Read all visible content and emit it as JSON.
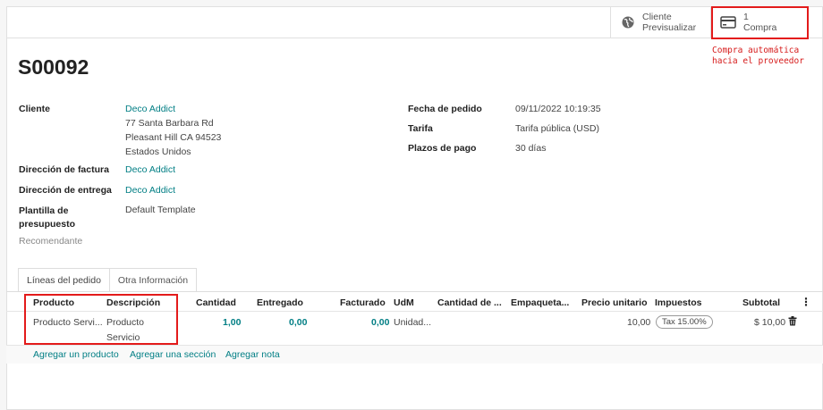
{
  "topbar": {
    "preview_label_1": "Cliente",
    "preview_label_2": "Previsualizar",
    "compra_count": "1",
    "compra_label": "Compra"
  },
  "annotation": {
    "line1": "Compra automática",
    "line2": "hacia el proveedor"
  },
  "order": {
    "name": "S00092"
  },
  "left_fields": {
    "cliente_label": "Cliente",
    "cliente_name": "Deco Addict",
    "cliente_addr1": "77 Santa Barbara Rd",
    "cliente_addr2": "Pleasant Hill CA 94523",
    "cliente_addr3": "Estados Unidos",
    "factura_label": "Dirección de factura",
    "factura_value": "Deco Addict",
    "entrega_label": "Dirección de entrega",
    "entrega_value": "Deco Addict",
    "plantilla_label_1": "Plantilla de",
    "plantilla_label_2": "presupuesto",
    "plantilla_value": "Default Template",
    "recomendante_label": "Recomendante"
  },
  "right_fields": {
    "fecha_label": "Fecha de pedido",
    "fecha_value": "09/11/2022 10:19:35",
    "tarifa_label": "Tarifa",
    "tarifa_value": "Tarifa pública (USD)",
    "plazos_label": "Plazos de pago",
    "plazos_value": "30 días"
  },
  "tabs": [
    "Líneas del pedido",
    "Otra Información"
  ],
  "table": {
    "headers": [
      "Producto",
      "Descripción",
      "Cantidad",
      "Entregado",
      "Facturado",
      "UdM",
      "Cantidad de ...",
      "Empaqueta...",
      "Precio unitario",
      "Impuestos",
      "Subtotal"
    ],
    "row": {
      "producto": "Producto Servi...",
      "descripcion_1": "Producto",
      "descripcion_2": "Servicio",
      "cantidad": "1,00",
      "entregado": "0,00",
      "facturado": "0,00",
      "udm": "Unidad...",
      "precio": "10,00",
      "impuesto": "Tax 15.00%",
      "subtotal": "$ 10,00"
    }
  },
  "add_links": [
    "Agregar un producto",
    "Agregar una sección",
    "Agregar nota"
  ],
  "colors": {
    "accent": "#017e84",
    "annotation": "#e31b1b"
  }
}
